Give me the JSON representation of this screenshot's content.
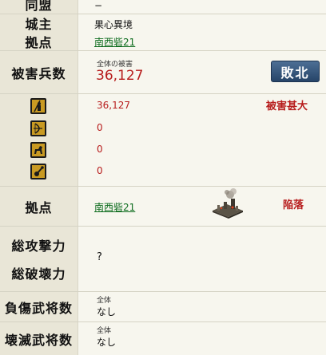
{
  "alliance": {
    "label": "同盟",
    "value": "−"
  },
  "lord": {
    "label": "城主",
    "value": "果心異境"
  },
  "base_top": {
    "label": "拠点",
    "value": "南西砦21"
  },
  "damage": {
    "label": "被害兵数",
    "sub_label": "全体の被害",
    "value": "36,127",
    "result_button": "敗北"
  },
  "units": {
    "status": "被害甚大",
    "rows": [
      {
        "icon": "spearman-icon",
        "value": "36,127"
      },
      {
        "icon": "archer-icon",
        "value": "0"
      },
      {
        "icon": "cavalry-icon",
        "value": "0"
      },
      {
        "icon": "siege-weapon-icon",
        "value": "0"
      }
    ]
  },
  "base_bottom": {
    "label": "拠点",
    "value": "南西砦21",
    "status": "陥落"
  },
  "power": {
    "attack_label": "総攻撃力",
    "destroy_label": "総破壊力",
    "value": "?"
  },
  "injured": {
    "label": "負傷武将数",
    "sub_label": "全体",
    "value": "なし"
  },
  "destroyed": {
    "label": "壊滅武将数",
    "sub_label": "全体",
    "value": "なし"
  },
  "colors": {
    "accent": "#b71c1c",
    "link": "#0b6b1c",
    "button": "#3a5a80"
  }
}
